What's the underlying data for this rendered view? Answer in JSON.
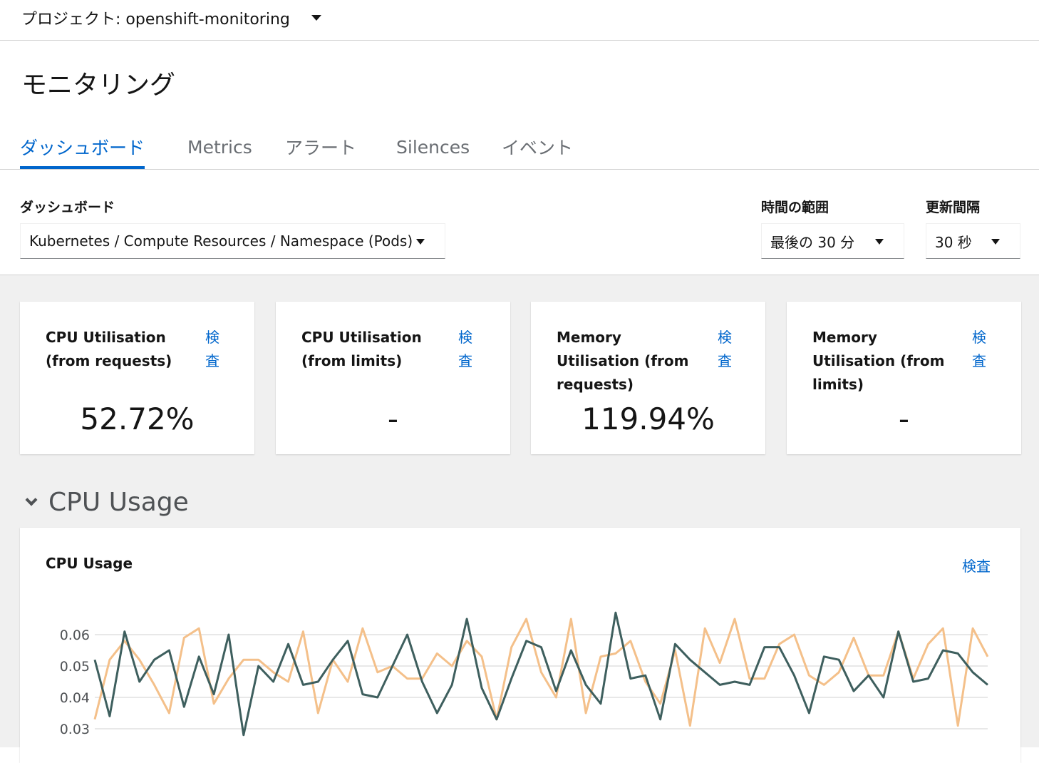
{
  "project": {
    "label": "プロジェクト: openshift-monitoring"
  },
  "page": {
    "title": "モニタリング"
  },
  "tabs": [
    {
      "label": "ダッシュボード",
      "active": true
    },
    {
      "label": "Metrics"
    },
    {
      "label": "アラート"
    },
    {
      "label": "Silences"
    },
    {
      "label": "イベント"
    }
  ],
  "controls": {
    "dashboard_label": "ダッシュボード",
    "dashboard_value": "Kubernetes / Compute Resources / Namespace (Pods)",
    "time_range_label": "時間の範囲",
    "time_range_value": "最後の 30 分",
    "refresh_label": "更新間隔",
    "refresh_value": "30 秒"
  },
  "cards": [
    {
      "title": "CPU Utilisation (from requests)",
      "inspect": "検査",
      "value": "52.72%"
    },
    {
      "title": "CPU Utilisation (from limits)",
      "inspect": "検査",
      "value": "-"
    },
    {
      "title": "Memory Utilisation (from requests)",
      "inspect": "検査",
      "value": "119.94%"
    },
    {
      "title": "Memory Utilisation (from limits)",
      "inspect": "検査",
      "value": "-"
    }
  ],
  "section": {
    "title": "CPU Usage"
  },
  "chart_panel": {
    "title": "CPU Usage",
    "inspect": "検査"
  },
  "colors": {
    "accent": "#0066cc",
    "series_orange": "#f4c145",
    "series_teal": "#3e5f5e"
  },
  "chart_data": {
    "type": "line",
    "title": "CPU Usage",
    "ylim": [
      0.025,
      0.07
    ],
    "yticks": [
      "0.06",
      "0.05",
      "0.04",
      "0.03"
    ],
    "ytick_values": [
      0.06,
      0.05,
      0.04,
      0.03
    ],
    "grid": true,
    "series": [
      {
        "color": "#f4c08a",
        "values": [
          0.033,
          0.052,
          0.058,
          0.052,
          0.044,
          0.035,
          0.059,
          0.062,
          0.038,
          0.046,
          0.052,
          0.052,
          0.048,
          0.045,
          0.061,
          0.035,
          0.052,
          0.045,
          0.062,
          0.048,
          0.05,
          0.046,
          0.046,
          0.054,
          0.05,
          0.058,
          0.053,
          0.033,
          0.056,
          0.065,
          0.048,
          0.04,
          0.065,
          0.035,
          0.053,
          0.054,
          0.058,
          0.045,
          0.038,
          0.055,
          0.031,
          0.062,
          0.051,
          0.065,
          0.046,
          0.046,
          0.057,
          0.06,
          0.047,
          0.044,
          0.048,
          0.059,
          0.047,
          0.047,
          0.061,
          0.046,
          0.057,
          0.062,
          0.031,
          0.062,
          0.053
        ]
      },
      {
        "color": "#3e5f5e",
        "values": [
          0.052,
          0.034,
          0.061,
          0.045,
          0.052,
          0.055,
          0.037,
          0.053,
          0.041,
          0.06,
          0.028,
          0.05,
          0.045,
          0.057,
          0.044,
          0.045,
          0.052,
          0.058,
          0.041,
          0.04,
          0.05,
          0.06,
          0.045,
          0.035,
          0.044,
          0.065,
          0.043,
          0.033,
          0.046,
          0.058,
          0.056,
          0.042,
          0.055,
          0.044,
          0.038,
          0.067,
          0.046,
          0.047,
          0.033,
          0.057,
          0.052,
          0.048,
          0.044,
          0.045,
          0.044,
          0.056,
          0.056,
          0.047,
          0.035,
          0.053,
          0.052,
          0.042,
          0.047,
          0.04,
          0.061,
          0.045,
          0.046,
          0.055,
          0.054,
          0.048,
          0.044
        ]
      }
    ]
  }
}
